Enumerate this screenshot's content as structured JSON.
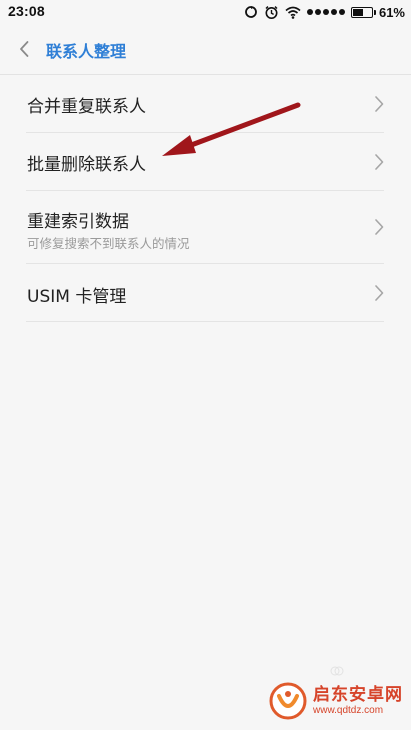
{
  "status_bar": {
    "time": "23:08",
    "battery_percent": "61%",
    "battery_level": 0.61,
    "icons": [
      "sync-icon",
      "alarm-icon",
      "wifi-icon",
      "signal-icon",
      "battery-icon"
    ]
  },
  "header": {
    "back_icon": "chevron-left-icon",
    "title": "联系人整理"
  },
  "menu": {
    "items": [
      {
        "label": "合并重复联系人",
        "sublabel": ""
      },
      {
        "label": "批量删除联系人",
        "sublabel": ""
      },
      {
        "label": "重建索引数据",
        "sublabel": "可修复搜索不到联系人的情况"
      },
      {
        "label": "USIM 卡管理",
        "sublabel": ""
      }
    ],
    "chevron_icon": "chevron-right-icon"
  },
  "annotation": {
    "type": "arrow",
    "color": "#a0161b",
    "points_to": "批量删除联系人"
  },
  "watermark": {
    "name": "启东安卓网",
    "url": "www.qdtdz.com",
    "color": "#d6442a"
  }
}
